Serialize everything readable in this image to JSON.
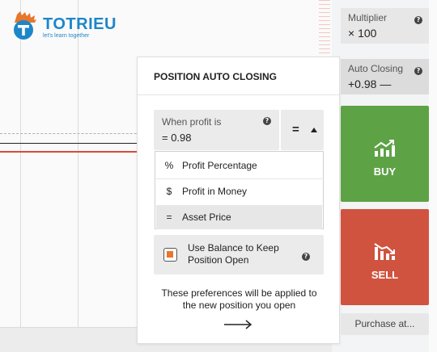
{
  "logo": {
    "title": "TOTRIEU",
    "tagline": "let's learn together"
  },
  "panel": {
    "title": "POSITION AUTO CLOSING",
    "condition_label": "When profit is",
    "condition_value": "= 0.98",
    "type_symbol": "=",
    "options": [
      {
        "symbol": "%",
        "label": "Profit Percentage",
        "selected": false
      },
      {
        "symbol": "$",
        "label": "Profit in Money",
        "selected": false
      },
      {
        "symbol": "=",
        "label": "Asset Price",
        "selected": true
      }
    ],
    "balance_checkbox_label_line1": "Use Balance to Keep",
    "balance_checkbox_label_line2": "Position Open",
    "note_line1": "These preferences will be applied to",
    "note_line2": "the new position you open"
  },
  "sidebar": {
    "multiplier_label": "Multiplier",
    "multiplier_value": "× 100",
    "auto_closing_label": "Auto Closing",
    "auto_closing_value": "+0.98 —",
    "buy_label": "BUY",
    "sell_label": "SELL",
    "purchase_label": "Purchase at..."
  },
  "colors": {
    "buy": "#5ea246",
    "sell": "#d0533f",
    "accent": "#e8762b",
    "brand": "#1d86c9"
  }
}
